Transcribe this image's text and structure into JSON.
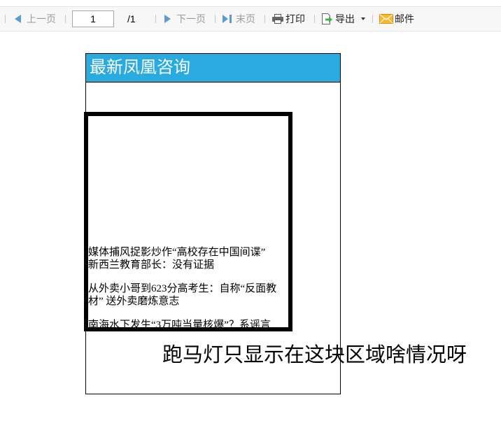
{
  "toolbar": {
    "prev_label": "上一页",
    "page_input_value": "1",
    "page_total": "/1",
    "next_label": "下一页",
    "last_label": "末页",
    "print_label": "打印",
    "export_label": "导出",
    "mail_label": "邮件"
  },
  "report": {
    "header_title": "最新凤凰咨询",
    "marquee": {
      "headlines": [
        {
          "lines": [
            "媒体捕风捉影炒作“高校存在中国间谍”",
            "新西兰教育部长：没有证据"
          ]
        },
        {
          "lines": [
            "从外卖小哥到623分高考生：自称“反面教",
            "材” 送外卖磨炼意志"
          ]
        },
        {
          "lines": [
            "南海水下发生“3万吨当量核爆”？系谣言"
          ]
        }
      ]
    }
  },
  "annotation": "跑马灯只显示在这块区域啥情况呀",
  "icons": {
    "prev": "prev-page-icon",
    "next": "next-page-icon",
    "last": "last-page-icon",
    "print": "printer-icon",
    "export": "export-icon",
    "export_menu": "chevron-down-icon",
    "mail": "mail-icon"
  },
  "colors": {
    "header_bg": "#29abe2",
    "header_text": "#ffffff",
    "nav_icon": "#5b9bd5",
    "disabled_text": "#9b9b9b",
    "toolbar_bg": "#f7f7f7"
  }
}
